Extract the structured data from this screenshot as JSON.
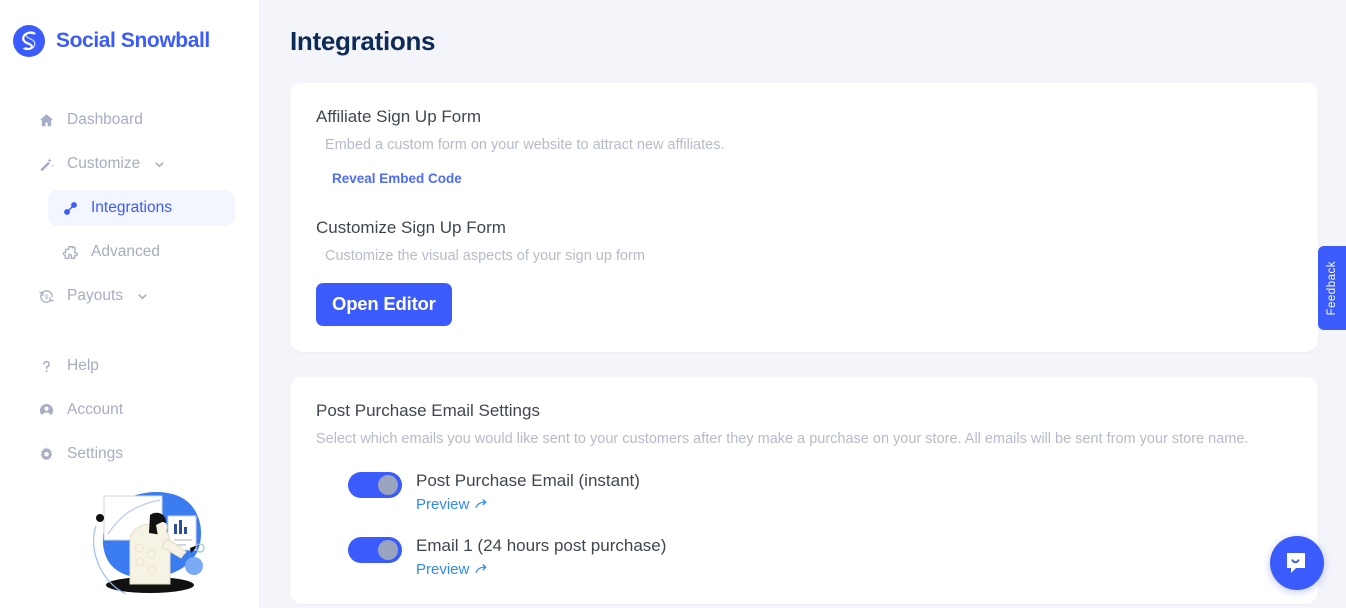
{
  "brand": {
    "name": "Social Snowball",
    "logo_icon": "snowball-s-logo-icon",
    "accent_color": "#3b5bfd"
  },
  "sidebar": {
    "items": [
      {
        "label": "Dashboard",
        "icon": "home-icon",
        "active": false,
        "sub": false,
        "caret": false
      },
      {
        "label": "Customize",
        "icon": "magic-wand-icon",
        "active": false,
        "sub": false,
        "caret": true
      },
      {
        "label": "Integrations",
        "icon": "link-chain-icon",
        "active": true,
        "sub": true,
        "caret": false
      },
      {
        "label": "Advanced",
        "icon": "puzzle-piece-icon",
        "active": false,
        "sub": true,
        "caret": false
      },
      {
        "label": "Payouts",
        "icon": "payouts-refresh-dollar-icon",
        "active": false,
        "sub": false,
        "caret": true
      }
    ],
    "bottom_items": [
      {
        "label": "Help",
        "icon": "question-mark-icon"
      },
      {
        "label": "Account",
        "icon": "user-circle-icon"
      },
      {
        "label": "Settings",
        "icon": "gear-icon"
      }
    ],
    "illustration_name": "person-presenting-chart-illustration"
  },
  "header": {
    "title": "Integrations"
  },
  "cards": {
    "signup_form": {
      "affiliate_form": {
        "title": "Affiliate Sign Up Form",
        "description": "Embed a custom form on your website to attract new affiliates.",
        "link_label": "Reveal Embed Code"
      },
      "customize_form": {
        "title": "Customize Sign Up Form",
        "description": "Customize the visual aspects of your sign up form",
        "button_label": "Open Editor"
      }
    },
    "post_purchase": {
      "title": "Post Purchase Email Settings",
      "description": "Select which emails you would like sent to your customers after they make a purchase on your store. All emails will be sent from your store name.",
      "preview_label": "Preview",
      "toggles": [
        {
          "label": "Post Purchase Email (instant)",
          "enabled": true,
          "preview_label": "Preview"
        },
        {
          "label": "Email 1 (24 hours post purchase)",
          "enabled": true,
          "preview_label": "Preview"
        }
      ]
    }
  },
  "floating": {
    "feedback_label": "Feedback",
    "chat_icon": "intercom-chat-smile-icon"
  }
}
